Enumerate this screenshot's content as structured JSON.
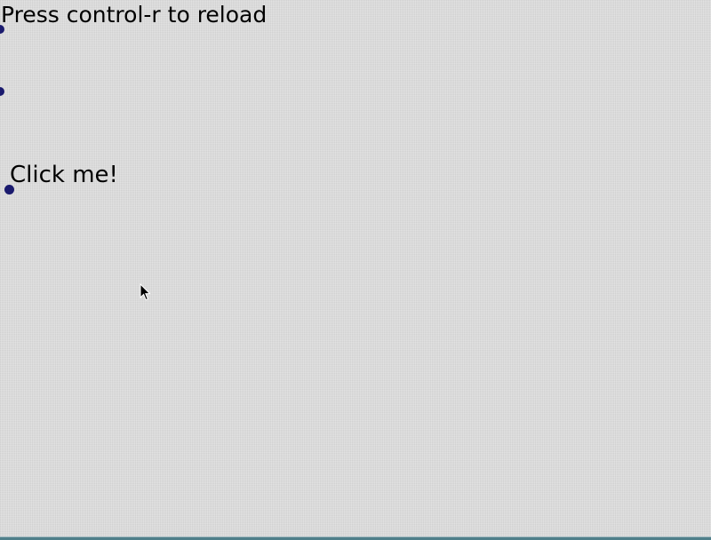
{
  "canvas": {
    "hint_text": "Press control-r to reload",
    "button_label": "Click me!"
  },
  "icons": {
    "handle_1": "blue-dot-icon",
    "handle_2": "blue-dot-icon",
    "handle_3": "blue-dot-icon",
    "cursor": "mouse-pointer-icon"
  },
  "colors": {
    "background": "#dcdcdc",
    "text": "#000000",
    "dot": "#1a1a6e",
    "bottom_bar": "#4f7f8a"
  }
}
